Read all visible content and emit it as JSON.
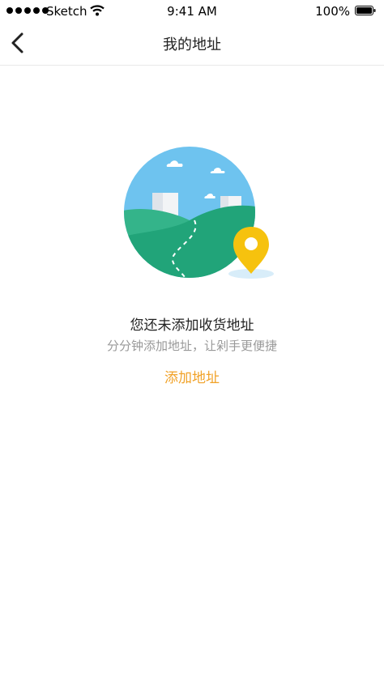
{
  "status_bar": {
    "carrier": "Sketch",
    "time": "9:41 AM",
    "battery": "100%"
  },
  "nav": {
    "title": "我的地址",
    "back_icon": "chevron-left-icon"
  },
  "empty_state": {
    "illustration": "address-map-illustration",
    "title": "您还未添加收货地址",
    "subtitle": "分分钟添加地址，让剁手更便捷",
    "action_label": "添加地址"
  },
  "colors": {
    "accent": "#f1a228",
    "sky": "#6ec3ef",
    "hill_light": "#34b48a",
    "hill_dark": "#21a479",
    "pin": "#f6c20e"
  }
}
